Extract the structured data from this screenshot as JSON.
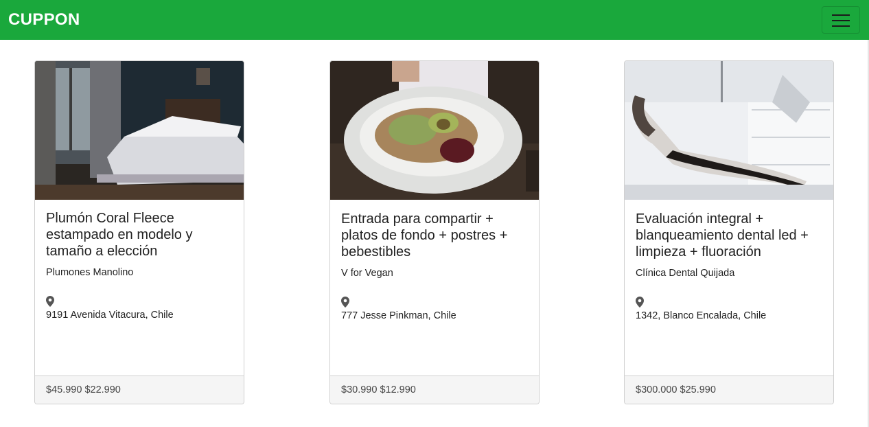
{
  "navbar": {
    "brand": "CUPPON",
    "toggle_icon": "hamburger-menu-icon",
    "background": "#1aa83c"
  },
  "cards": [
    {
      "image_alt": "bedroom-photo",
      "title": "Plumón Coral Fleece estampado en modelo y tamaño a elección",
      "company": "Plumones Manolino",
      "location_icon": "map-pin-icon",
      "address": "9191 Avenida Vitacura, Chile",
      "price": "$45.990 $22.990"
    },
    {
      "image_alt": "vegan-salad-photo",
      "title": "Entrada para compartir + platos de fondo + postres + bebestibles",
      "company": "V for Vegan",
      "location_icon": "map-pin-icon",
      "address": "777 Jesse Pinkman, Chile",
      "price": "$30.990 $12.990"
    },
    {
      "image_alt": "dental-chair-photo",
      "title": "Evaluación integral + blanqueamiento dental led + limpieza + fluoración",
      "company": "Clínica Dental Quijada",
      "location_icon": "map-pin-icon",
      "address": "1342, Blanco Encalada, Chile",
      "price": "$300.000 $25.990"
    }
  ]
}
